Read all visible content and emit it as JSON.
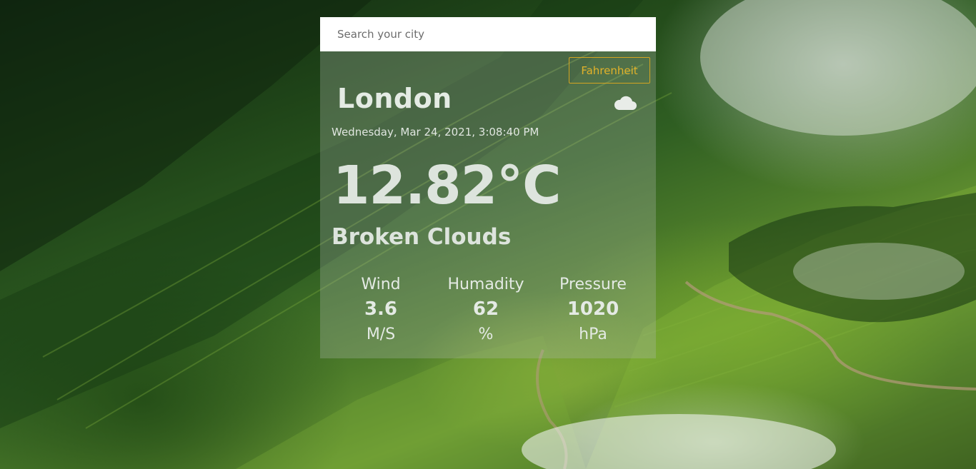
{
  "search": {
    "placeholder": "Search your city",
    "value": ""
  },
  "unit_toggle": {
    "label": "Fahrenheit",
    "accent_color": "#d4a521"
  },
  "weather": {
    "city": "London",
    "datetime": "Wednesday, Mar 24, 2021, 3:08:40 PM",
    "temperature": "12.82°C",
    "description": "Broken Clouds",
    "icon": "cloud-icon"
  },
  "stats": {
    "wind": {
      "label": "Wind",
      "value": "3.6",
      "unit": "M/S"
    },
    "humidity": {
      "label": "Humadity",
      "value": "62",
      "unit": "%"
    },
    "pressure": {
      "label": "Pressure",
      "value": "1020",
      "unit": "hPa"
    }
  }
}
